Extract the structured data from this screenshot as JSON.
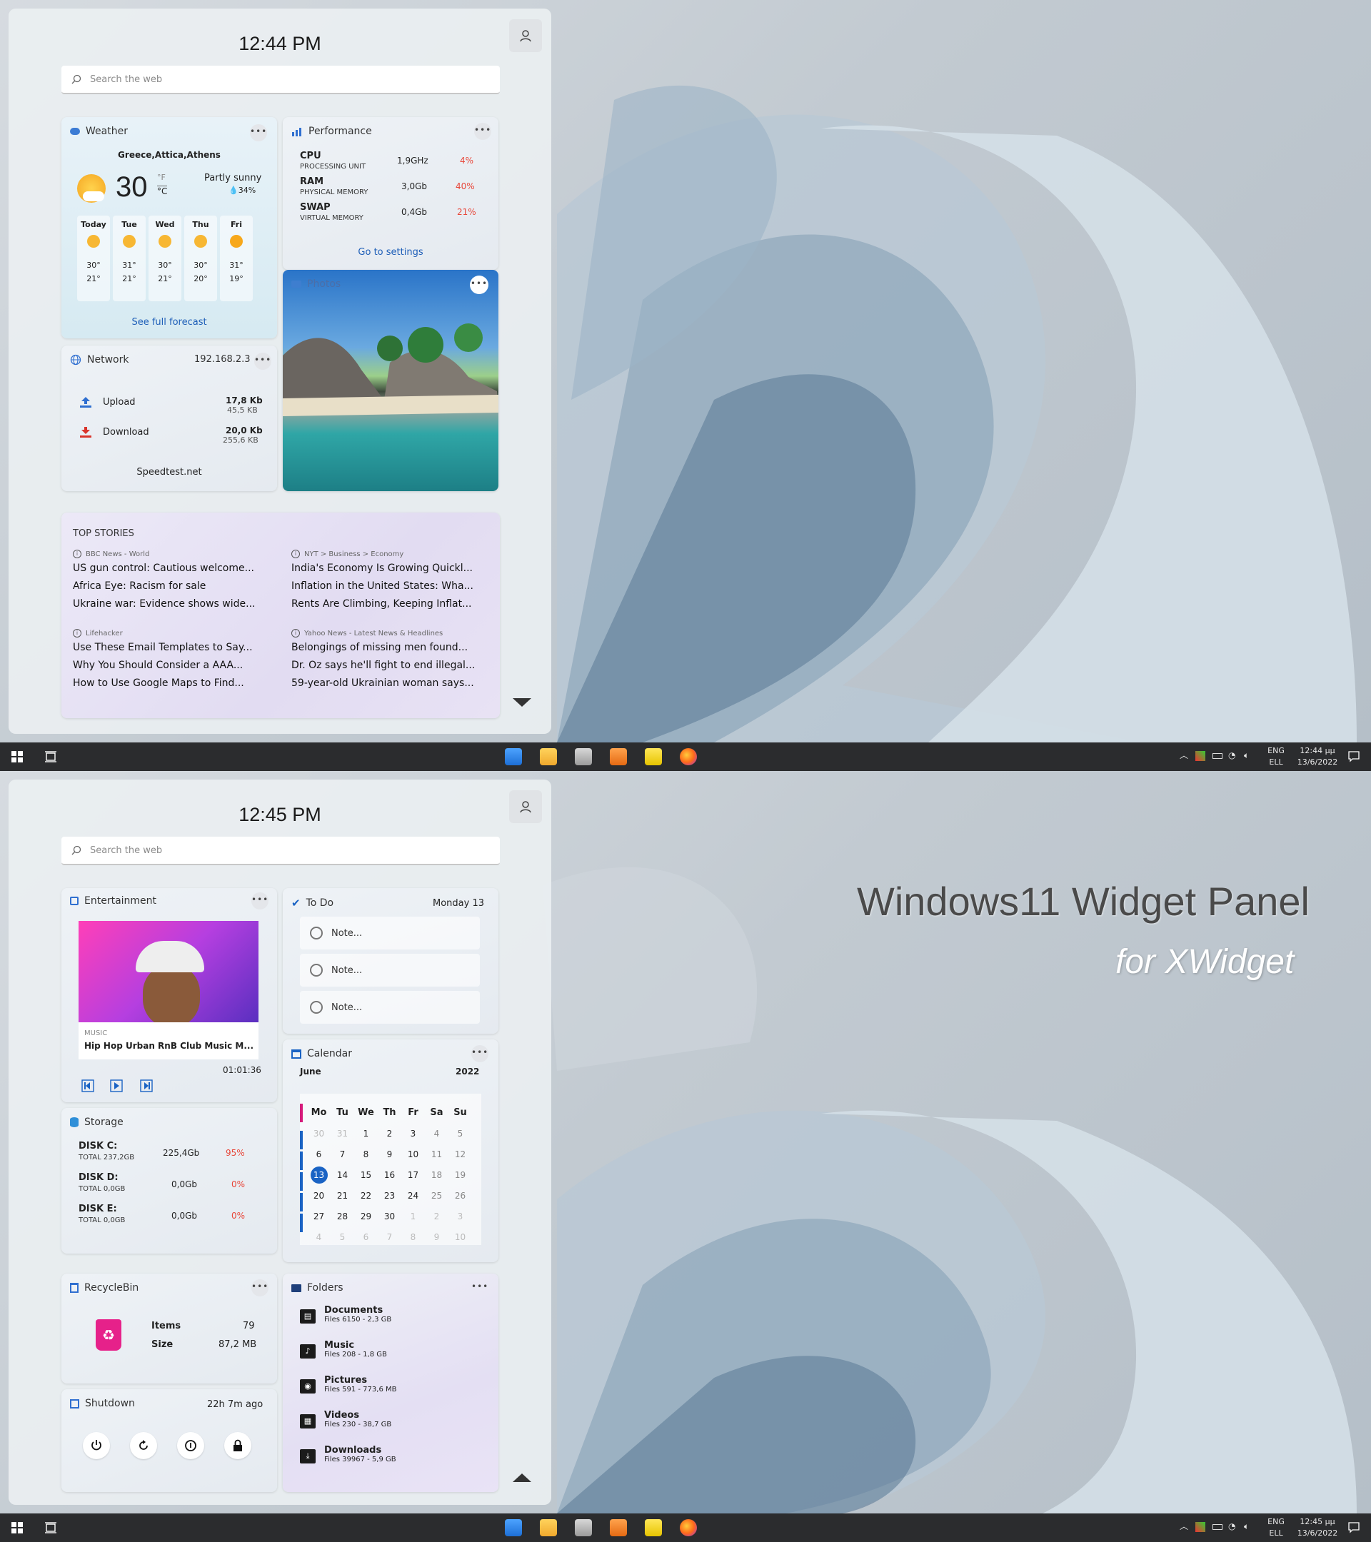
{
  "screen1": {
    "clock": "12:44 PM",
    "search_placeholder": "Search the web",
    "weather": {
      "title": "Weather",
      "location": "Greece,Attica,Athens",
      "temp": "30",
      "unit_f": "°F",
      "unit_c": "°C",
      "condition": "Partly sunny",
      "humidity": "34%",
      "forecast": [
        {
          "day": "Today",
          "high": "30°",
          "low": "21°"
        },
        {
          "day": "Tue",
          "high": "31°",
          "low": "21°"
        },
        {
          "day": "Wed",
          "high": "30°",
          "low": "21°"
        },
        {
          "day": "Thu",
          "high": "30°",
          "low": "20°"
        },
        {
          "day": "Fri",
          "high": "31°",
          "low": "19°"
        }
      ],
      "link": "See full forecast"
    },
    "performance": {
      "title": "Performance",
      "rows": [
        {
          "name": "CPU",
          "sub": "PROCESSING UNIT",
          "value": "1,9GHz",
          "pct": "4%"
        },
        {
          "name": "RAM",
          "sub": "PHYSICAL MEMORY",
          "value": "3,0Gb",
          "pct": "40%"
        },
        {
          "name": "SWAP",
          "sub": "VIRTUAL MEMORY",
          "value": "0,4Gb",
          "pct": "21%"
        }
      ],
      "link": "Go to settings"
    },
    "photos": {
      "title": "Photos"
    },
    "network": {
      "title": "Network",
      "ip": "192.168.2.3",
      "upload_label": "Upload",
      "upload_rate": "17,8 Kb",
      "upload_total": "45,5 KB",
      "download_label": "Download",
      "download_rate": "20,0 Kb",
      "download_total": "255,6 KB",
      "link": "Speedtest.net"
    },
    "stories": {
      "title": "TOP STORIES",
      "groups": [
        {
          "source": "BBC News - World",
          "items": [
            "US gun control: Cautious welcome...",
            "Africa Eye: Racism for sale",
            "Ukraine war: Evidence shows wide..."
          ]
        },
        {
          "source": "NYT > Business > Economy",
          "items": [
            "India's Economy Is Growing Quickl...",
            "Inflation in the United States: Wha...",
            "Rents Are Climbing, Keeping Inflat..."
          ]
        },
        {
          "source": "Lifehacker",
          "items": [
            "Use These Email Templates to Say...",
            "Why You Should Consider a AAA...",
            "How to Use Google Maps to Find..."
          ]
        },
        {
          "source": "Yahoo News - Latest News & Headlines",
          "items": [
            "Belongings of missing men found...",
            "Dr. Oz says he'll fight to end illegal...",
            "59-year-old Ukrainian woman says..."
          ]
        }
      ]
    },
    "tray": {
      "lang1": "ENG",
      "lang2": "ELL",
      "time": "12:44 μμ",
      "date": "13/6/2022"
    }
  },
  "screen2": {
    "clock": "12:45 PM",
    "search_placeholder": "Search the web",
    "entertainment": {
      "title": "Entertainment",
      "category": "MUSIC",
      "track": "Hip Hop Urban RnB Club Music M...",
      "duration": "01:01:36"
    },
    "todo": {
      "title": "To Do",
      "date": "Monday 13",
      "notes": [
        "Note...",
        "Note...",
        "Note..."
      ]
    },
    "calendar": {
      "title": "Calendar",
      "month": "June",
      "year": "2022",
      "weekdays": [
        "Mo",
        "Tu",
        "We",
        "Th",
        "Fr",
        "Sa",
        "Su"
      ],
      "weeks": [
        [
          "30",
          "31",
          "1",
          "2",
          "3",
          "4",
          "5"
        ],
        [
          "6",
          "7",
          "8",
          "9",
          "10",
          "11",
          "12"
        ],
        [
          "13",
          "14",
          "15",
          "16",
          "17",
          "18",
          "19"
        ],
        [
          "20",
          "21",
          "22",
          "23",
          "24",
          "25",
          "26"
        ],
        [
          "27",
          "28",
          "29",
          "30",
          "1",
          "2",
          "3"
        ],
        [
          "4",
          "5",
          "6",
          "7",
          "8",
          "9",
          "10"
        ]
      ],
      "today": "13"
    },
    "storage": {
      "title": "Storage",
      "disks": [
        {
          "name": "DISK C:",
          "total": "TOTAL 237,2GB",
          "value": "225,4Gb",
          "pct": "95%"
        },
        {
          "name": "DISK D:",
          "total": "TOTAL 0,0GB",
          "value": "0,0Gb",
          "pct": "0%"
        },
        {
          "name": "DISK E:",
          "total": "TOTAL 0,0GB",
          "value": "0,0Gb",
          "pct": "0%"
        }
      ]
    },
    "recycle": {
      "title": "RecycleBin",
      "items_label": "Items",
      "items_value": "79",
      "size_label": "Size",
      "size_value": "87,2 MB"
    },
    "folders": {
      "title": "Folders",
      "list": [
        {
          "name": "Documents",
          "info": "Files 6150 - 2,3 GB"
        },
        {
          "name": "Music",
          "info": "Files 208 - 1,8 GB"
        },
        {
          "name": "Pictures",
          "info": "Files 591 - 773,6 MB"
        },
        {
          "name": "Videos",
          "info": "Files 230 - 38,7 GB"
        },
        {
          "name": "Downloads",
          "info": "Files 39967 - 5,9 GB"
        }
      ]
    },
    "shutdown": {
      "title": "Shutdown",
      "uptime": "22h 7m ago"
    },
    "banner_title": "Windows11 Widget Panel",
    "banner_sub": "for XWidget",
    "tray": {
      "lang1": "ENG",
      "lang2": "ELL",
      "time": "12:45 μμ",
      "date": "13/6/2022"
    }
  },
  "colors": {
    "accent": "#1a63c4",
    "red": "#e8473a",
    "taskbar": "#2b2c2e"
  }
}
